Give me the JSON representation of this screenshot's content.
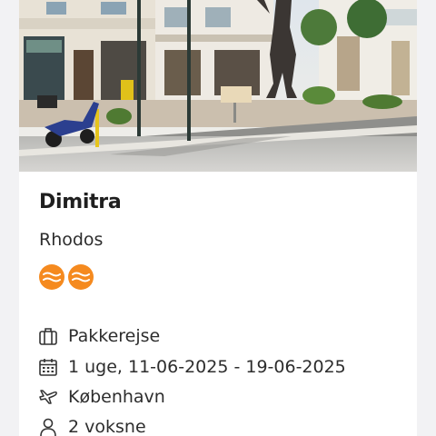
{
  "offer": {
    "hotel_name": "Dimitra",
    "destination": "Rhodos",
    "rating": {
      "count": 2,
      "icon": "wave-icon",
      "color": "#f58a1f"
    },
    "details": {
      "trip_type": "Pakkerejse",
      "dates": "1 uge, 11-06-2025 - 19-06-2025",
      "departure": "København",
      "travellers": "2 voksne"
    }
  },
  "icons": {
    "trip_type": "suitcase-icon",
    "dates": "calendar-icon",
    "departure": "airplane-icon",
    "travellers": "person-icon"
  }
}
